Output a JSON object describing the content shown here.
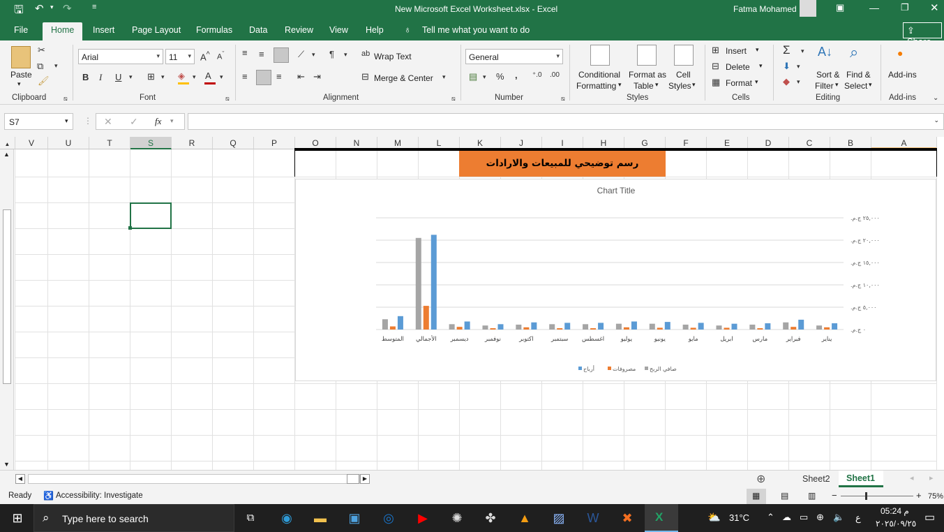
{
  "titlebar": {
    "file_title": "New Microsoft Excel Worksheet.xlsx  -  Excel",
    "user": "Fatma Mohamed"
  },
  "tabs": [
    "File",
    "Home",
    "Insert",
    "Page Layout",
    "Formulas",
    "Data",
    "Review",
    "View",
    "Help"
  ],
  "tell_me": "Tell me what you want to do",
  "share": "Share",
  "ribbon": {
    "paste": "Paste",
    "clipboard": "Clipboard",
    "font_name": "Arial",
    "font_size": "11",
    "font": "Font",
    "bold": "B",
    "italic": "I",
    "underline": "U",
    "wrap_text": "Wrap Text",
    "merge_center": "Merge & Center",
    "alignment": "Alignment",
    "number_format": "General",
    "number": "Number",
    "conditional": "Conditional",
    "formatting": "Formatting",
    "format_as": "Format as",
    "table": "Table",
    "cell": "Cell",
    "styles_btn": "Styles",
    "styles": "Styles",
    "insert": "Insert",
    "delete": "Delete",
    "format": "Format",
    "cells": "Cells",
    "sort": "Sort &",
    "filter": "Filter",
    "find": "Find &",
    "select": "Select",
    "editing": "Editing",
    "addins_btn": "Add-ins",
    "addins": "Add-ins"
  },
  "formula_bar": {
    "name_box": "S7",
    "fx": "fx",
    "value": ""
  },
  "columns": [
    "V",
    "U",
    "T",
    "S",
    "R",
    "Q",
    "P",
    "O",
    "N",
    "M",
    "L",
    "K",
    "J",
    "I",
    "H",
    "G",
    "F",
    "E",
    "D",
    "C",
    "B",
    "A"
  ],
  "banner": "رسم توضيحي للمبيعات والارادات",
  "chart_data": {
    "type": "bar",
    "title": "Chart Title",
    "categories": [
      "يناير",
      "فبراير",
      "مارس",
      "ابريل",
      "مايو",
      "يونيو",
      "يوليو",
      "اغسطس",
      "سبتمبر",
      "اكتوبر",
      "نوفمبر",
      "ديسمبر",
      "الأجمالي",
      "المتوسط"
    ],
    "series": [
      {
        "name": "صافي الربح",
        "color": "#a5a5a5",
        "values": [
          900,
          1600,
          1100,
          900,
          1100,
          1300,
          1300,
          1200,
          1200,
          1100,
          900,
          1200,
          20500,
          2300
        ]
      },
      {
        "name": "مصروفات",
        "color": "#ed7d31",
        "values": [
          500,
          600,
          300,
          400,
          400,
          400,
          500,
          300,
          300,
          500,
          300,
          600,
          5300,
          700
        ]
      },
      {
        "name": "أرباح",
        "color": "#5b9bd5",
        "values": [
          1400,
          2200,
          1400,
          1300,
          1500,
          1700,
          1800,
          1500,
          1500,
          1600,
          1200,
          1800,
          21200,
          3000
        ]
      }
    ],
    "ylim": [
      0,
      25000
    ],
    "ytick_labels": [
      "٠ ج.م.‏",
      "٥,٠٠٠ ج.م.‏",
      "١٠,٠٠٠ ج.م.‏",
      "١٥,٠٠٠ ج.م.‏",
      "٢٠,٠٠٠ ج.م.‏",
      "٢٥,٠٠٠ ج.م.‏"
    ],
    "legend_position": "bottom",
    "grid": true
  },
  "sheets": [
    "Sheet2",
    "Sheet1"
  ],
  "status": {
    "ready": "Ready",
    "accessibility": "Accessibility: Investigate",
    "zoom": "75%"
  },
  "taskbar": {
    "search": "Type here to search",
    "temp": "31°C",
    "lang": "ع",
    "time": "05:24 م",
    "date": "٢٠٢٥/٠٩/٢٥"
  }
}
